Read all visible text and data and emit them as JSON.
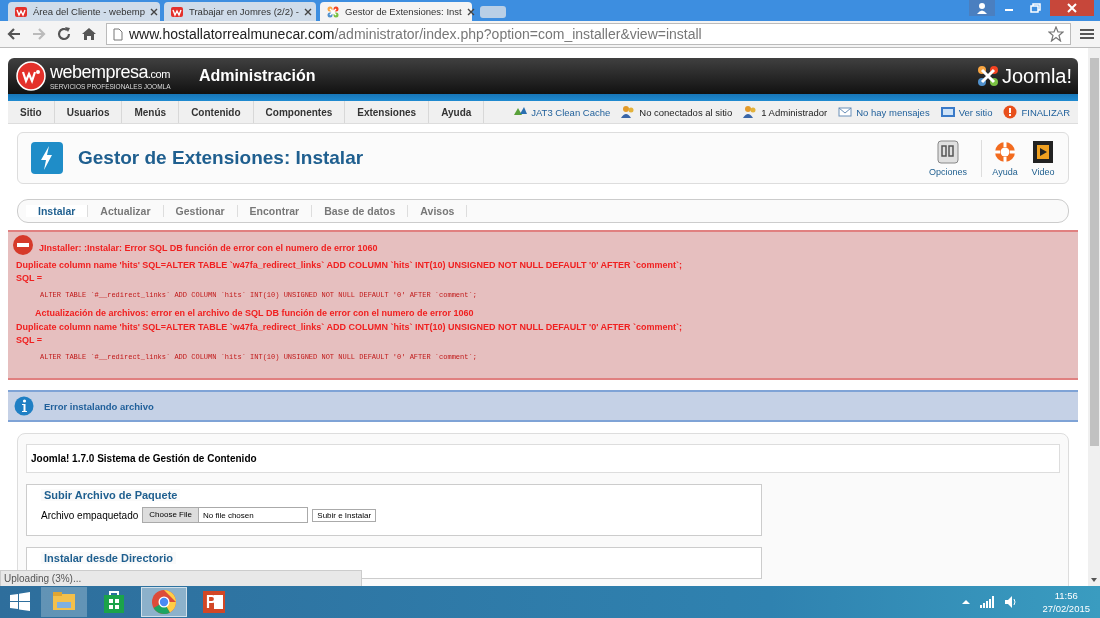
{
  "browser": {
    "tabs": [
      {
        "title": "Área del Cliente - webemp",
        "kind": "webempresa",
        "selected": false
      },
      {
        "title": "Trabajar en Jomres (2/2) -",
        "kind": "webempresa",
        "selected": false
      },
      {
        "title": "Gestor de Extensiones: Inst",
        "kind": "joomla",
        "selected": true
      }
    ],
    "url_host": "www.hostallatorrealmunecar.com",
    "url_path": "/administrator/index.php?option=com_installer&view=install"
  },
  "header": {
    "brand": "webempresa",
    "brand_suffix": ".com",
    "tagline": "SERVICIOS PROFESIONALES JOOMLA",
    "title": "Administración",
    "logo": "Joomla!"
  },
  "menu": [
    "Sitio",
    "Usuarios",
    "Menús",
    "Contenido",
    "Componentes",
    "Extensiones",
    "Ayuda"
  ],
  "status_links": [
    {
      "label": "JAT3 Clean Cache",
      "kind": "cache"
    },
    {
      "label": "No conectados al sitio",
      "kind": "users"
    },
    {
      "label": "1 Administrador",
      "kind": "users"
    },
    {
      "label": "No hay mensajes",
      "kind": "messages"
    },
    {
      "label": "Ver sitio",
      "kind": "site"
    },
    {
      "label": "FINALIZAR",
      "kind": "logout"
    }
  ],
  "page_title": "Gestor de Extensiones: Instalar",
  "toolbar": [
    {
      "label": "Opciones",
      "kind": "options"
    },
    {
      "label": "Ayuda",
      "kind": "help"
    },
    {
      "label": "Video",
      "kind": "video"
    }
  ],
  "submenu": [
    {
      "label": "Instalar",
      "selected": true
    },
    {
      "label": "Actualizar",
      "selected": false
    },
    {
      "label": "Gestionar",
      "selected": false
    },
    {
      "label": "Encontrar",
      "selected": false
    },
    {
      "label": "Base de datos",
      "selected": false
    },
    {
      "label": "Avisos",
      "selected": false
    }
  ],
  "error_messages": [
    {
      "heading": "JInstaller: :Instalar: Error SQL DB función de error con el numero de error 1060",
      "detail": "Duplicate column name 'hits' SQL=ALTER TABLE `w47fa_redirect_links` ADD COLUMN `hits` INT(10) UNSIGNED NOT NULL DEFAULT '0' AFTER `comment`;",
      "sql_label": "SQL =",
      "sql": "ALTER TABLE `#__redirect_links` ADD COLUMN `hits` INT(10) UNSIGNED NOT NULL DEFAULT '0' AFTER `comment`;"
    },
    {
      "heading": "Actualización de archivos: error en el archivo de SQL DB función de error con el numero de error 1060",
      "detail": "Duplicate column name 'hits' SQL=ALTER TABLE `w47fa_redirect_links` ADD COLUMN `hits` INT(10) UNSIGNED NOT NULL DEFAULT '0' AFTER `comment`;",
      "sql_label": "SQL =",
      "sql": "ALTER TABLE `#__redirect_links` ADD COLUMN `hits` INT(10) UNSIGNED NOT NULL DEFAULT '0' AFTER `comment`;"
    }
  ],
  "info_message": "Error instalando archivo",
  "panel": {
    "version": "Joomla! 1.7.0 Sistema de Gestión de Contenido",
    "upload": {
      "legend": "Subir Archivo de Paquete",
      "label": "Archivo empaquetado",
      "choose_button": "Choose File",
      "file_status": "No file chosen",
      "submit": "Subir e Instalar"
    },
    "directory_legend": "Instalar desde Directorio"
  },
  "download_status": "Uploading (3%)...",
  "taskbar": {
    "apps": [
      {
        "kind": "explorer",
        "selected": false
      },
      {
        "kind": "store",
        "selected": false
      },
      {
        "kind": "chrome",
        "selected": true
      },
      {
        "kind": "powerpoint",
        "selected": false
      }
    ],
    "time": "11:56",
    "date": "27/02/2015"
  }
}
